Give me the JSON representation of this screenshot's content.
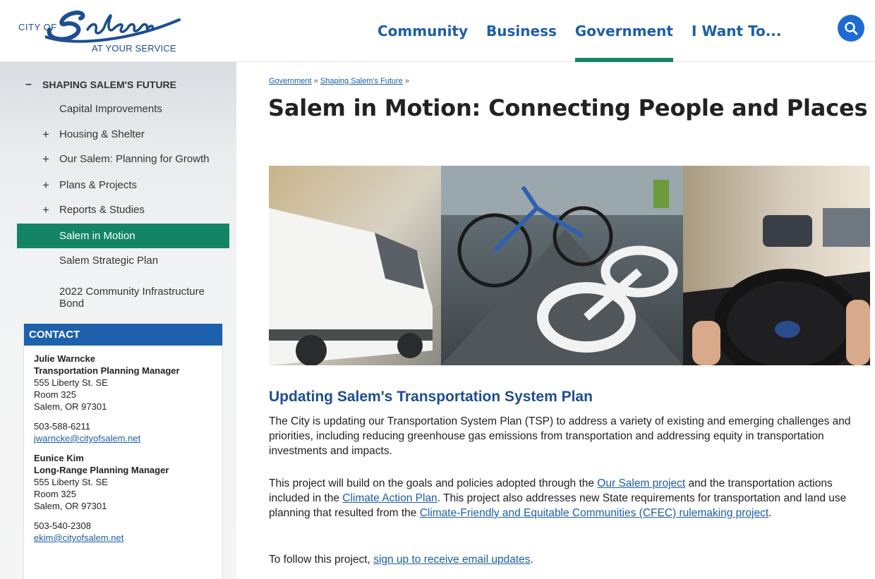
{
  "header": {
    "logo": {
      "prefix": "CITY OF",
      "script_word": "Salem",
      "tagline": "AT YOUR SERVICE"
    },
    "nav": [
      {
        "label": "Community",
        "active": false
      },
      {
        "label": "Business",
        "active": false
      },
      {
        "label": "Government",
        "active": true
      },
      {
        "label": "I Want To...",
        "active": false
      }
    ],
    "search_icon": "search-icon",
    "colors": {
      "nav_text": "#1d5fa6",
      "active_underline": "#148564",
      "search_bg": "#1d6ad0"
    }
  },
  "sidebar": {
    "section": {
      "label": "SHAPING SALEM'S FUTURE",
      "toggle": "–"
    },
    "items": [
      {
        "label": "Capital Improvements",
        "expander": ""
      },
      {
        "label": "Housing & Shelter",
        "expander": "+"
      },
      {
        "label": "Our Salem: Planning for Growth",
        "expander": "+"
      },
      {
        "label": "Plans & Projects",
        "expander": "+"
      },
      {
        "label": "Reports & Studies",
        "expander": "+"
      },
      {
        "label": "Salem in Motion",
        "expander": "",
        "active": true
      },
      {
        "label": "Salem Strategic Plan",
        "expander": ""
      },
      {
        "label": "2022 Community Infrastructure Bond",
        "expander": ""
      }
    ],
    "colors": {
      "active_bg": "#148564"
    }
  },
  "contact": {
    "heading": "CONTACT",
    "people": [
      {
        "name": "Julie Warncke",
        "title": "Transportation Planning Manager",
        "address1": "555 Liberty St. SE",
        "address2": "Room 325",
        "city": "Salem, OR 97301",
        "phone": "503-588-6211",
        "email": "jwarncke@cityofsalem.net"
      },
      {
        "name": "Eunice Kim",
        "title": "Long-Range Planning Manager",
        "address1": "555 Liberty St. SE",
        "address2": "Room 325",
        "city": "Salem, OR 97301",
        "phone": "503-540-2308",
        "email": "ekim@cityofsalem.net"
      }
    ],
    "colors": {
      "heading_bg": "#1d61ad"
    }
  },
  "main": {
    "breadcrumb": {
      "items": [
        "Government",
        "Shaping Salem's Future"
      ],
      "separator": "»"
    },
    "title": "Salem in Motion: Connecting People and Places",
    "section_title": "Updating Salem's Transportation System Plan",
    "paragraph1": "The City is updating our Transportation System Plan (TSP) to address a variety of existing and emerging challenges and priorities, including reducing greenhouse gas emissions from transportation and addressing equity in transportation investments and impacts.",
    "paragraph2": {
      "t1": "This project will build on the goals and policies adopted through the ",
      "link1": "Our Salem project",
      "t2": " and the transportation actions included in the ",
      "link2": "Climate Action Plan",
      "t3": ". This project also addresses new State requirements for transportation and land use planning that resulted from the ",
      "link3": "Climate-Friendly and Equitable Communities (CFEC) rulemaking project",
      "t4": "."
    },
    "paragraph3": {
      "t1": "To follow this project, ",
      "link1": "sign up to receive email updates",
      "t2": "."
    }
  }
}
